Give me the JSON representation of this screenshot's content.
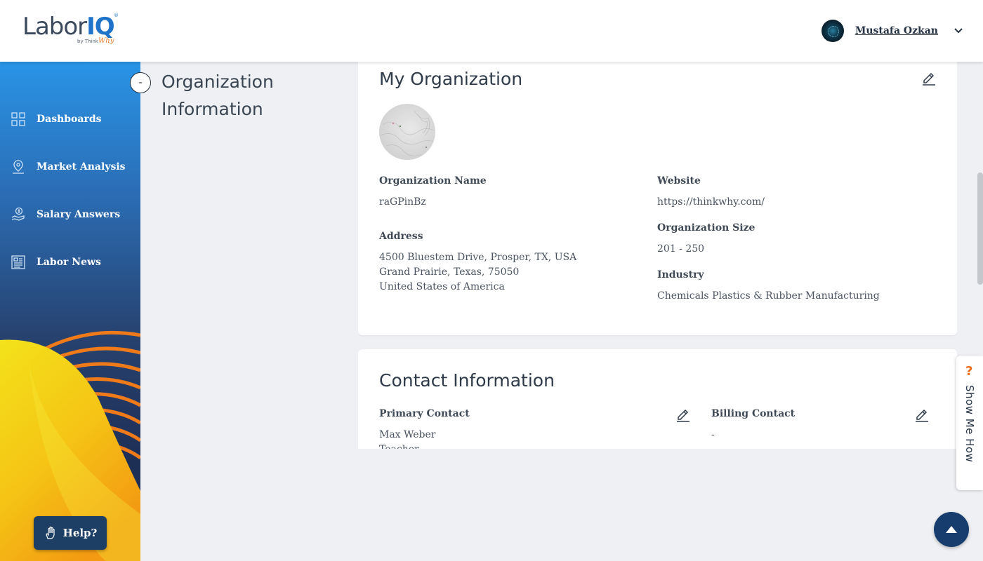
{
  "header": {
    "logo": {
      "main": "Labor",
      "accent": "IQ",
      "tm": "®",
      "by": "by Think",
      "by_accent": "Why"
    },
    "user_name": "Mustafa Ozkan"
  },
  "sidebar": {
    "items": [
      {
        "label": "Dashboards",
        "icon": "grid-icon"
      },
      {
        "label": "Market Analysis",
        "icon": "map-pin-icon"
      },
      {
        "label": "Salary Answers",
        "icon": "salary-hand-icon"
      },
      {
        "label": "Labor News",
        "icon": "newspaper-icon"
      }
    ],
    "help_label": "Help?"
  },
  "section": {
    "collapse_symbol": "-",
    "title": "Organization Information"
  },
  "org_card": {
    "title": "My Organization",
    "fields": {
      "org_name_label": "Organization Name",
      "org_name_value": "raGPinBz",
      "address_label": "Address",
      "address_line1": "4500 Bluestem Drive, Prosper, TX, USA",
      "address_line2": "Grand Prairie, Texas, 75050",
      "address_line3": "United States of America",
      "website_label": "Website",
      "website_value": "https://thinkwhy.com/",
      "size_label": "Organization Size",
      "size_value": "201 - 250",
      "industry_label": "Industry",
      "industry_value": "Chemicals Plastics & Rubber Manufacturing"
    }
  },
  "contact_card": {
    "title": "Contact Information",
    "primary_label": "Primary Contact",
    "primary_name": "Max Weber",
    "primary_role": "Teacher",
    "billing_label": "Billing Contact",
    "billing_value": "-"
  },
  "show_me_how": {
    "q": "?",
    "label": "Show Me How"
  },
  "colors": {
    "accent_blue": "#1f73c8",
    "nav_dark": "#1d3f66",
    "orange": "#ef6c1b"
  }
}
